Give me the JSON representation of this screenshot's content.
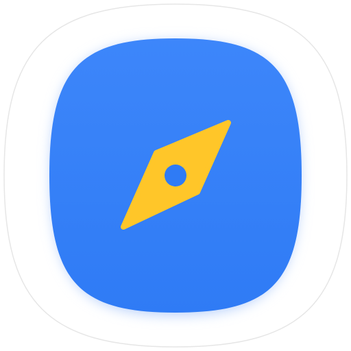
{
  "app_icon": {
    "icon_name": "compass-icon",
    "colors": {
      "outer_background": "#ffffff",
      "outer_border": "#e6e6e6",
      "tile_fill": "#2f7bf5",
      "tile_fill_light": "#3d86fa",
      "tile_glow": "#bcd3fb",
      "needle": "#ffc629",
      "needle_center": "#2f7bf5"
    }
  }
}
